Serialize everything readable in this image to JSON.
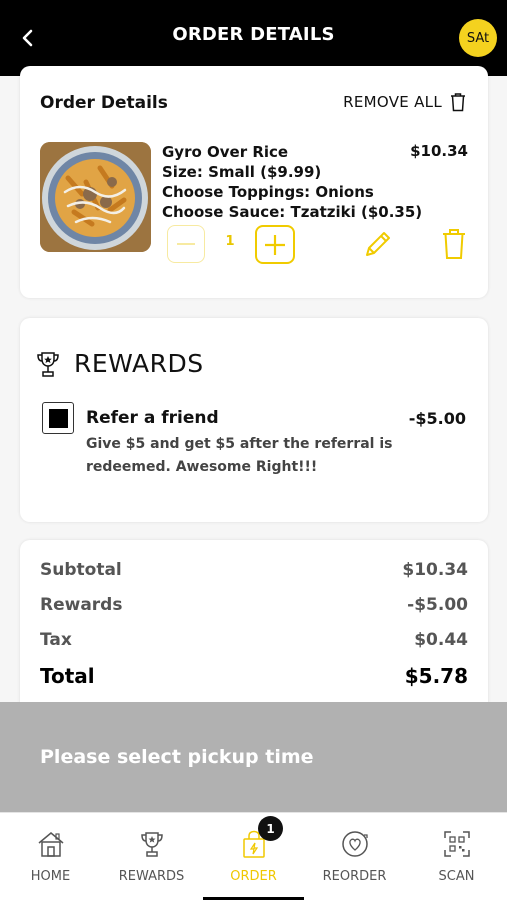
{
  "header": {
    "title": "ORDER DETAILS",
    "avatar_text": "SAt",
    "back_icon": "chevron-left-icon"
  },
  "order": {
    "section_title": "Order Details",
    "remove_all_label": "REMOVE ALL",
    "items": [
      {
        "name": "Gyro Over Rice",
        "size": "Size: Small ($9.99)",
        "toppings": "Choose Toppings: Onions",
        "sauce": "Choose Sauce: Tzatziki ($0.35)",
        "price": "$10.34",
        "quantity": "1"
      }
    ]
  },
  "rewards": {
    "title": "REWARDS",
    "items": [
      {
        "title": "Refer a friend",
        "description": "Give $5 and get $5 after the referral is redeemed. Awesome Right!!!",
        "amount": "-$5.00",
        "checked": true
      }
    ]
  },
  "totals": {
    "subtotal_label": "Subtotal",
    "subtotal_value": "$10.34",
    "rewards_label": "Rewards",
    "rewards_value": "-$5.00",
    "tax_label": "Tax",
    "tax_value": "$0.44",
    "total_label": "Total",
    "total_value": "$5.78"
  },
  "pickup": {
    "label": "Please select pickup time"
  },
  "tabbar": {
    "tabs": [
      {
        "label": "HOME",
        "icon": "home-icon"
      },
      {
        "label": "REWARDS",
        "icon": "trophy-icon"
      },
      {
        "label": "ORDER",
        "icon": "shopping-bag-icon",
        "active": true
      },
      {
        "label": "REORDER",
        "icon": "reorder-heart-icon"
      },
      {
        "label": "SCAN",
        "icon": "qr-scan-icon"
      }
    ],
    "order_badge": "1"
  },
  "colors": {
    "header_bg": "#000000",
    "accent": "#f4d21f",
    "pickup_bg": "#b1b1b1",
    "active_tab": "#f0c800"
  }
}
